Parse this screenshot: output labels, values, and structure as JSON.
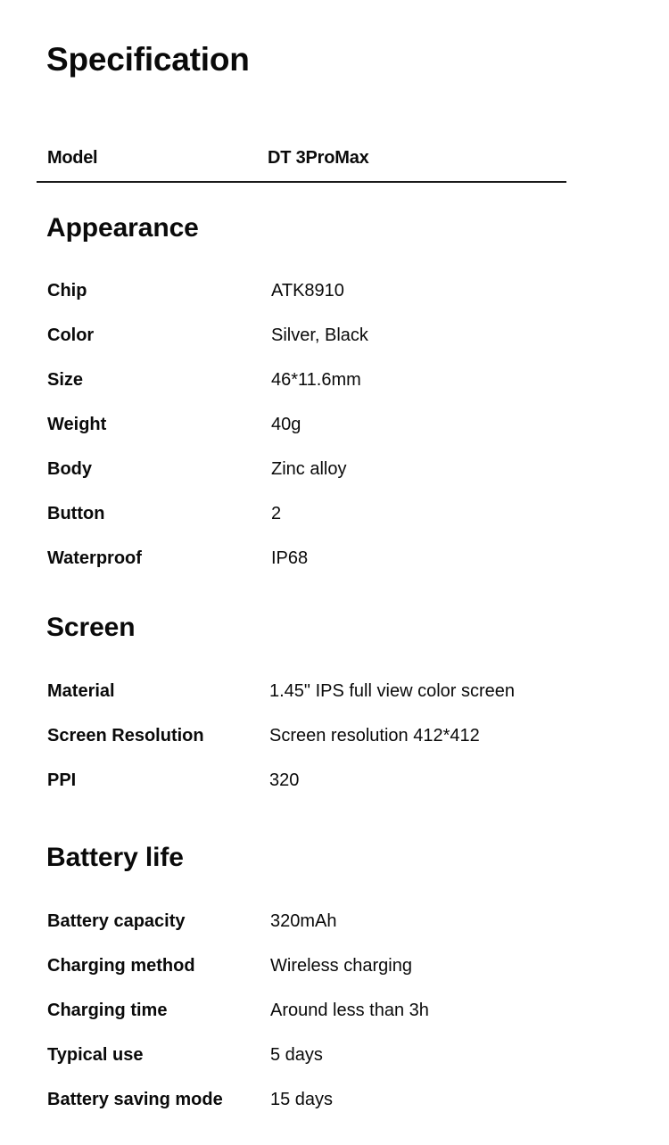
{
  "title": "Specification",
  "model": {
    "label": "Model",
    "value": "DT 3ProMax"
  },
  "sections": [
    {
      "title": "Appearance",
      "rows": [
        {
          "label": "Chip",
          "value": "ATK8910"
        },
        {
          "label": "Color",
          "value": "Silver, Black"
        },
        {
          "label": "Size",
          "value": "46*11.6mm"
        },
        {
          "label": "Weight",
          "value": "40g"
        },
        {
          "label": "Body",
          "value": "Zinc alloy"
        },
        {
          "label": "Button",
          "value": "2"
        },
        {
          "label": "Waterproof",
          "value": "IP68"
        }
      ]
    },
    {
      "title": "Screen",
      "rows": [
        {
          "label": "Material",
          "value": "1.45\" IPS full view color screen"
        },
        {
          "label": "Screen Resolution",
          "value": "Screen resolution 412*412"
        },
        {
          "label": "PPI",
          "value": "320"
        }
      ]
    },
    {
      "title": "Battery life",
      "rows": [
        {
          "label": "Battery capacity",
          "value": "320mAh"
        },
        {
          "label": "Charging method",
          "value": "Wireless charging"
        },
        {
          "label": "Charging time",
          "value": "Around less than 3h"
        },
        {
          "label": "Typical use",
          "value": "5 days"
        },
        {
          "label": "Battery saving mode",
          "value": "15 days"
        }
      ]
    }
  ]
}
